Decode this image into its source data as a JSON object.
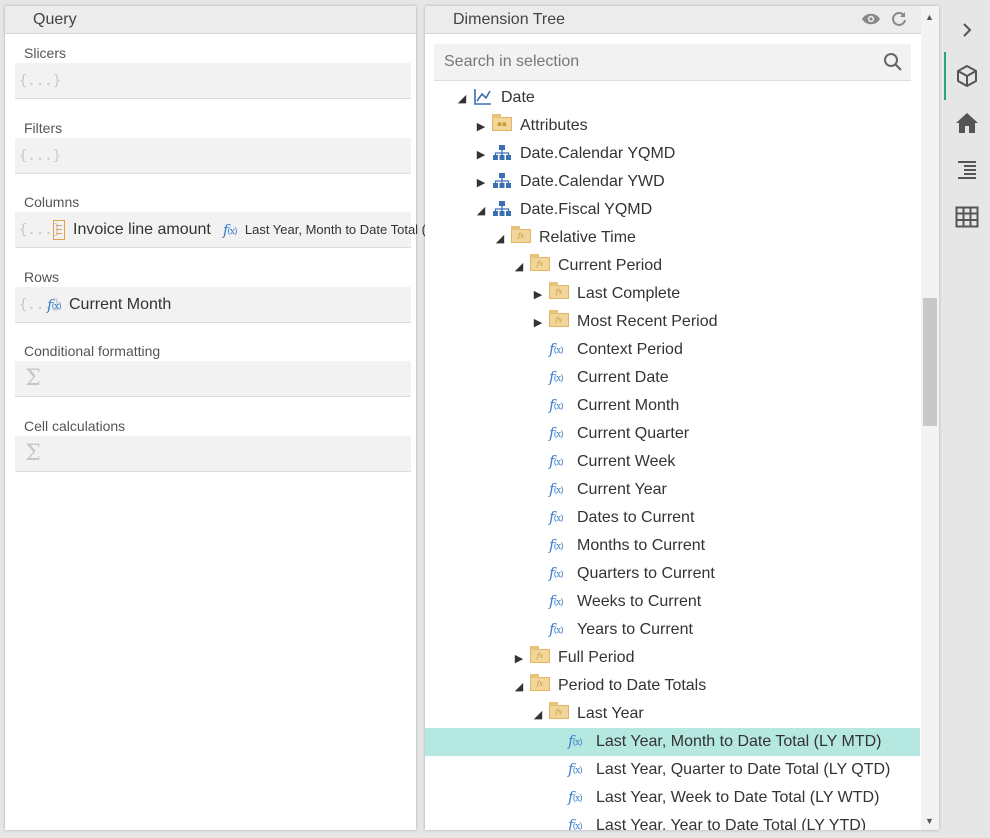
{
  "query": {
    "title": "Query",
    "slicers_label": "Slicers",
    "filters_label": "Filters",
    "columns_label": "Columns",
    "rows_label": "Rows",
    "conditional_label": "Conditional formatting",
    "cell_calc_label": "Cell calculations",
    "placeholder": "{...}",
    "columns_items": [
      "Invoice line amount",
      "Last Year, Month to Date Total (LY MTD)"
    ],
    "rows_items": [
      "Current Month"
    ]
  },
  "tree": {
    "title": "Dimension Tree",
    "search_placeholder": "Search in selection",
    "nodes": [
      {
        "label": "Date",
        "icon": "date-hierarchy-icon",
        "arrow": "expanded"
      },
      {
        "label": "Attributes",
        "icon": "attributes-folder-icon",
        "arrow": "collapsed"
      },
      {
        "label": "Date.Calendar YQMD",
        "icon": "hierarchy-icon",
        "arrow": "collapsed"
      },
      {
        "label": "Date.Calendar YWD",
        "icon": "hierarchy-icon",
        "arrow": "collapsed"
      },
      {
        "label": "Date.Fiscal YQMD",
        "icon": "hierarchy-icon",
        "arrow": "expanded"
      },
      {
        "label": "Relative Time",
        "icon": "fx-folder-icon",
        "arrow": "expanded"
      },
      {
        "label": "Current Period",
        "icon": "fx-folder-icon",
        "arrow": "expanded"
      },
      {
        "label": "Last Complete",
        "icon": "fx-folder-icon",
        "arrow": "collapsed"
      },
      {
        "label": "Most Recent Period",
        "icon": "fx-folder-icon",
        "arrow": "collapsed"
      },
      {
        "label": "Context Period",
        "icon": "function-icon",
        "arrow": ""
      },
      {
        "label": "Current Date",
        "icon": "function-icon",
        "arrow": ""
      },
      {
        "label": "Current Month",
        "icon": "function-icon",
        "arrow": ""
      },
      {
        "label": "Current Quarter",
        "icon": "function-icon",
        "arrow": ""
      },
      {
        "label": "Current Week",
        "icon": "function-icon",
        "arrow": ""
      },
      {
        "label": "Current Year",
        "icon": "function-icon",
        "arrow": ""
      },
      {
        "label": "Dates to Current",
        "icon": "function-icon",
        "arrow": ""
      },
      {
        "label": "Months to Current",
        "icon": "function-icon",
        "arrow": ""
      },
      {
        "label": "Quarters to Current",
        "icon": "function-icon",
        "arrow": ""
      },
      {
        "label": "Weeks to Current",
        "icon": "function-icon",
        "arrow": ""
      },
      {
        "label": "Years to Current",
        "icon": "function-icon",
        "arrow": ""
      },
      {
        "label": "Full Period",
        "icon": "fx-folder-icon",
        "arrow": "collapsed"
      },
      {
        "label": "Period to Date Totals",
        "icon": "fx-folder-icon",
        "arrow": "expanded"
      },
      {
        "label": "Last Year",
        "icon": "fx-folder-icon",
        "arrow": "expanded"
      },
      {
        "label": "Last Year, Month to Date Total (LY MTD)",
        "icon": "function-icon",
        "arrow": "",
        "selected": true
      },
      {
        "label": "Last Year, Quarter to Date Total (LY QTD)",
        "icon": "function-icon",
        "arrow": ""
      },
      {
        "label": "Last Year, Week to Date Total (LY WTD)",
        "icon": "function-icon",
        "arrow": ""
      },
      {
        "label": "Last Year, Year to Date Total (LY YTD)",
        "icon": "function-icon",
        "arrow": ""
      }
    ]
  },
  "colors": {
    "accent": "#2aa37f",
    "selected_row": "#b5e8e0",
    "function_blue": "#3c7fc9",
    "folder": "#f1d59a"
  }
}
